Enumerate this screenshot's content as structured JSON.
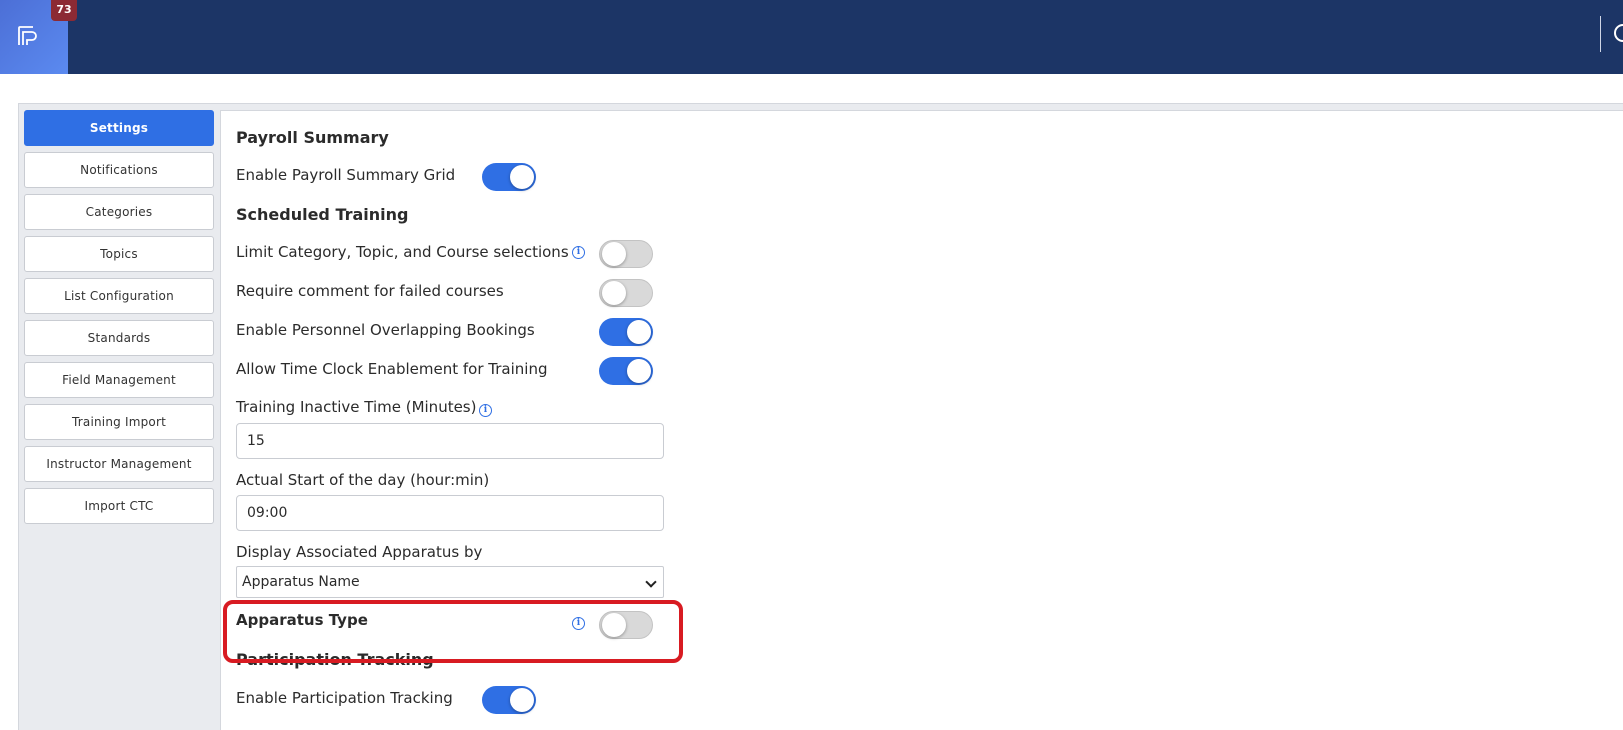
{
  "header": {
    "notification_count": "73",
    "logo_icon": "document-logo-icon",
    "right_icon": "search-icon",
    "colors": {
      "bar": "#1c3566",
      "badge": "#8c2a34"
    }
  },
  "sidebar": {
    "items": [
      {
        "label": "Settings",
        "active": true
      },
      {
        "label": "Notifications",
        "active": false
      },
      {
        "label": "Categories",
        "active": false
      },
      {
        "label": "Topics",
        "active": false
      },
      {
        "label": "List Configuration",
        "active": false
      },
      {
        "label": "Standards",
        "active": false
      },
      {
        "label": "Field Management",
        "active": false
      },
      {
        "label": "Training Import",
        "active": false
      },
      {
        "label": "Instructor Management",
        "active": false
      },
      {
        "label": "Import CTC",
        "active": false
      }
    ]
  },
  "panel": {
    "payroll": {
      "title": "Payroll Summary",
      "enable_grid": {
        "label": "Enable Payroll Summary Grid",
        "enabled": true
      }
    },
    "scheduled": {
      "title": "Scheduled Training",
      "limit_selections": {
        "label": "Limit Category, Topic, and Course selections",
        "enabled": false
      },
      "require_comment": {
        "label": "Require comment for failed courses",
        "enabled": false
      },
      "overlapping": {
        "label": "Enable Personnel Overlapping Bookings",
        "enabled": true
      },
      "time_clock": {
        "label": "Allow Time Clock Enablement for Training",
        "enabled": true
      }
    },
    "inactive_time": {
      "label": "Training Inactive Time (Minutes)",
      "value": "15"
    },
    "start_of_day": {
      "label": "Actual Start of the day (hour:min)",
      "value": "09:00"
    },
    "apparatus_display": {
      "label": "Display Associated Apparatus by",
      "selected": "Apparatus Name"
    },
    "apparatus_type": {
      "label": "Apparatus Type",
      "enabled": false
    },
    "participation": {
      "title": "Participation Tracking",
      "enable": {
        "label": "Enable Participation Tracking",
        "enabled": true
      }
    },
    "info_glyph": "i",
    "colors": {
      "accent": "#2f6fe4",
      "highlight": "#d81b22"
    }
  }
}
